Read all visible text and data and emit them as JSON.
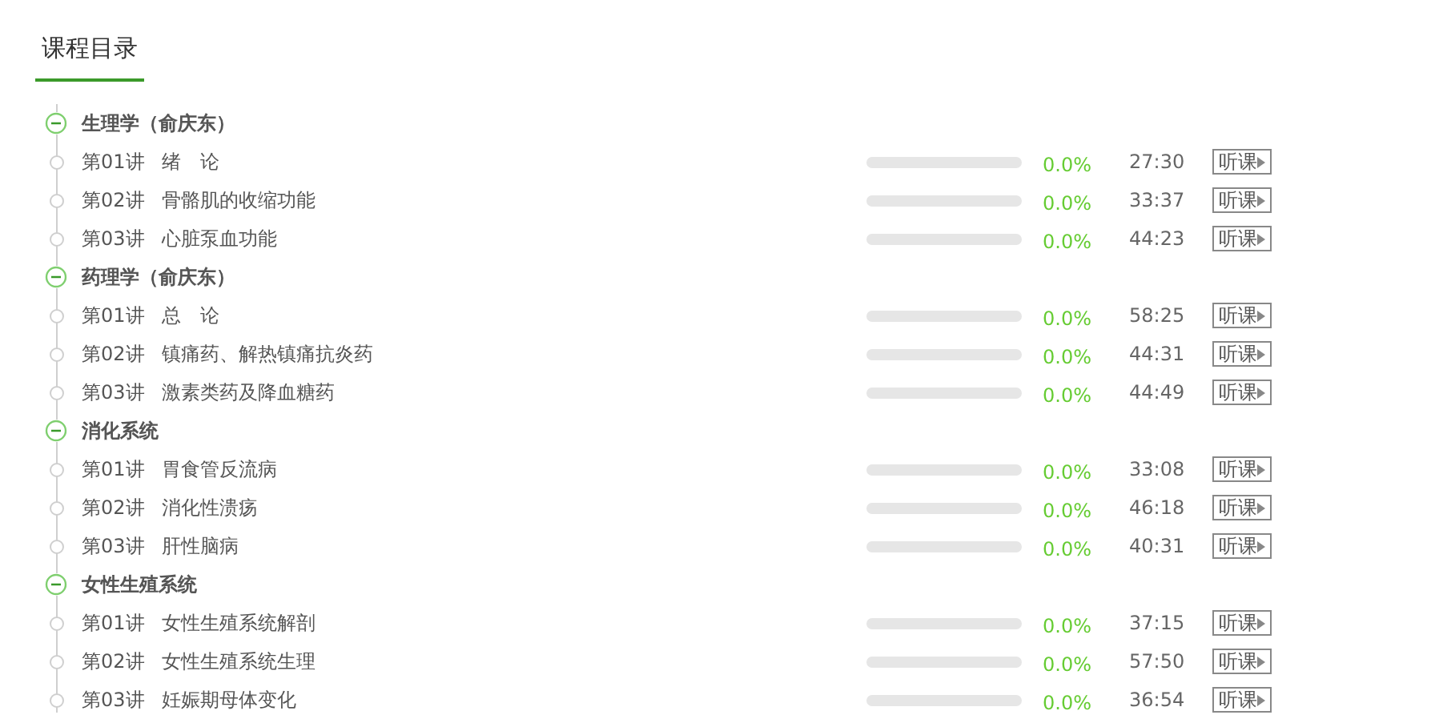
{
  "header": {
    "title": "课程目录"
  },
  "sections": [
    {
      "title": "生理学（俞庆东）",
      "expanded": true,
      "lessons": [
        {
          "number": "第01讲",
          "title": "绪　论",
          "level": 0,
          "percent": "0.0%",
          "duration": "27:30",
          "button": "听课"
        },
        {
          "number": "第02讲",
          "title": "骨骼肌的收缩功能",
          "level": 0,
          "percent": "0.0%",
          "duration": "33:37",
          "button": "听课"
        },
        {
          "number": "第03讲",
          "title": "心脏泵血功能",
          "level": 0,
          "percent": "0.0%",
          "duration": "44:23",
          "button": "听课"
        }
      ]
    },
    {
      "title": "药理学（俞庆东）",
      "expanded": true,
      "lessons": [
        {
          "number": "第01讲",
          "title": "总　论",
          "level": 0,
          "percent": "0.0%",
          "duration": "58:25",
          "button": "听课"
        },
        {
          "number": "第02讲",
          "title": "镇痛药、解热镇痛抗炎药",
          "level": 0,
          "percent": "0.0%",
          "duration": "44:31",
          "button": "听课"
        },
        {
          "number": "第03讲",
          "title": "激素类药及降血糖药",
          "level": 0,
          "percent": "0.0%",
          "duration": "44:49",
          "button": "听课"
        }
      ]
    },
    {
      "title": "消化系统",
      "expanded": true,
      "lessons": [
        {
          "number": "第01讲",
          "title": "胃食管反流病",
          "level": 0,
          "percent": "0.0%",
          "duration": "33:08",
          "button": "听课"
        },
        {
          "number": "第02讲",
          "title": "消化性溃疡",
          "level": 0,
          "percent": "0.0%",
          "duration": "46:18",
          "button": "听课"
        },
        {
          "number": "第03讲",
          "title": "肝性脑病",
          "level": 0,
          "percent": "0.0%",
          "duration": "40:31",
          "button": "听课"
        }
      ]
    },
    {
      "title": "女性生殖系统",
      "expanded": true,
      "lessons": [
        {
          "number": "第01讲",
          "title": "女性生殖系统解剖",
          "level": 0,
          "percent": "0.0%",
          "duration": "37:15",
          "button": "听课"
        },
        {
          "number": "第02讲",
          "title": "女性生殖系统生理",
          "level": 0,
          "percent": "0.0%",
          "duration": "57:50",
          "button": "听课"
        },
        {
          "number": "第03讲",
          "title": "妊娠期母体变化",
          "level": 0,
          "percent": "0.0%",
          "duration": "36:54",
          "button": "听课"
        }
      ]
    }
  ]
}
